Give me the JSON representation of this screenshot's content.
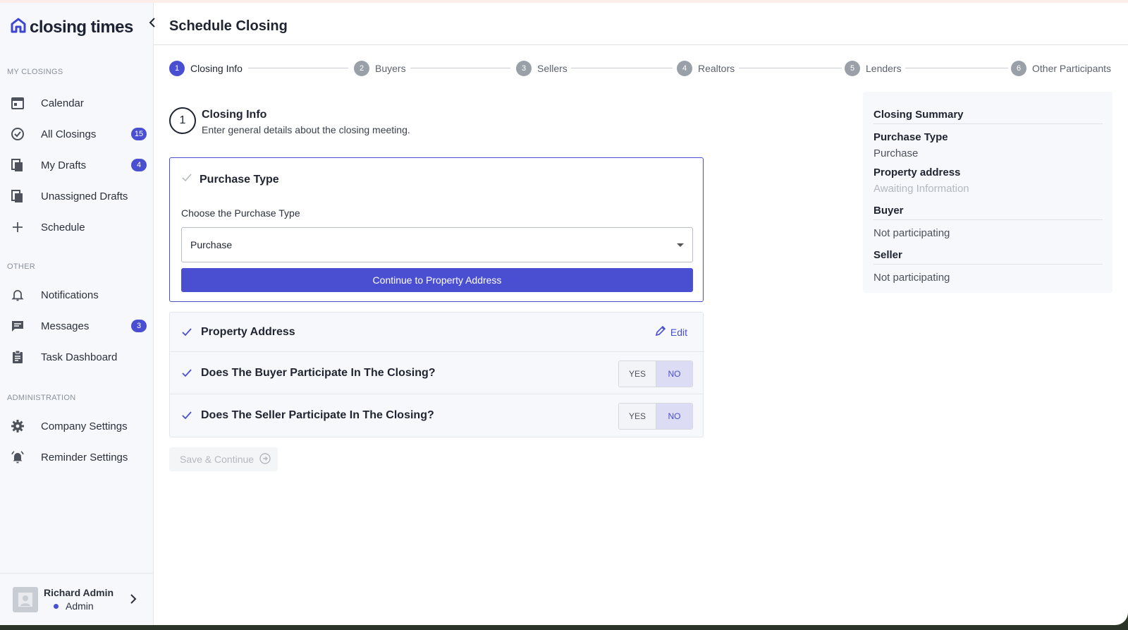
{
  "app": {
    "logo_text": "closing times"
  },
  "sidebar": {
    "sections": {
      "my_closings": "MY CLOSINGS",
      "other": "OTHER",
      "administration": "ADMINISTRATION"
    },
    "items": [
      {
        "label": "Calendar",
        "icon": "calendar-icon"
      },
      {
        "label": "All Closings",
        "icon": "check-circle-icon",
        "badge": "15"
      },
      {
        "label": "My Drafts",
        "icon": "documents-icon",
        "badge": "4"
      },
      {
        "label": "Unassigned Drafts",
        "icon": "documents-icon"
      },
      {
        "label": "Schedule",
        "icon": "plus-icon"
      },
      {
        "label": "Notifications",
        "icon": "bell-icon"
      },
      {
        "label": "Messages",
        "icon": "chat-icon",
        "badge": "3"
      },
      {
        "label": "Task Dashboard",
        "icon": "clipboard-icon"
      },
      {
        "label": "Company Settings",
        "icon": "gear-icon"
      },
      {
        "label": "Reminder Settings",
        "icon": "bell-ring-icon"
      }
    ],
    "user": {
      "name": "Richard Admin",
      "role": "Admin"
    }
  },
  "header": {
    "title": "Schedule Closing"
  },
  "stepper": [
    {
      "num": "1",
      "label": "Closing Info",
      "active": true
    },
    {
      "num": "2",
      "label": "Buyers"
    },
    {
      "num": "3",
      "label": "Sellers"
    },
    {
      "num": "4",
      "label": "Realtors"
    },
    {
      "num": "5",
      "label": "Lenders"
    },
    {
      "num": "6",
      "label": "Other Participants"
    }
  ],
  "section": {
    "num": "1",
    "title": "Closing Info",
    "subtitle": "Enter general details about the closing meeting."
  },
  "purchase_card": {
    "title": "Purchase Type",
    "field_label": "Choose the Purchase Type",
    "selected": "Purchase",
    "continue_label": "Continue to Property Address"
  },
  "rows": {
    "property_address": {
      "title": "Property Address",
      "edit_label": "Edit"
    },
    "buyer": {
      "title": "Does The Buyer Participate In The Closing?",
      "yes": "YES",
      "no": "NO"
    },
    "seller": {
      "title": "Does The Seller Participate In The Closing?",
      "yes": "YES",
      "no": "NO"
    }
  },
  "save_label": "Save & Continue",
  "summary": {
    "title": "Closing Summary",
    "purchase_type_label": "Purchase Type",
    "purchase_type_value": "Purchase",
    "property_address_label": "Property address",
    "property_address_value": "Awaiting Information",
    "buyer_label": "Buyer",
    "buyer_value": "Not participating",
    "seller_label": "Seller",
    "seller_value": "Not participating"
  },
  "colors": {
    "accent": "#4a4fd1"
  }
}
